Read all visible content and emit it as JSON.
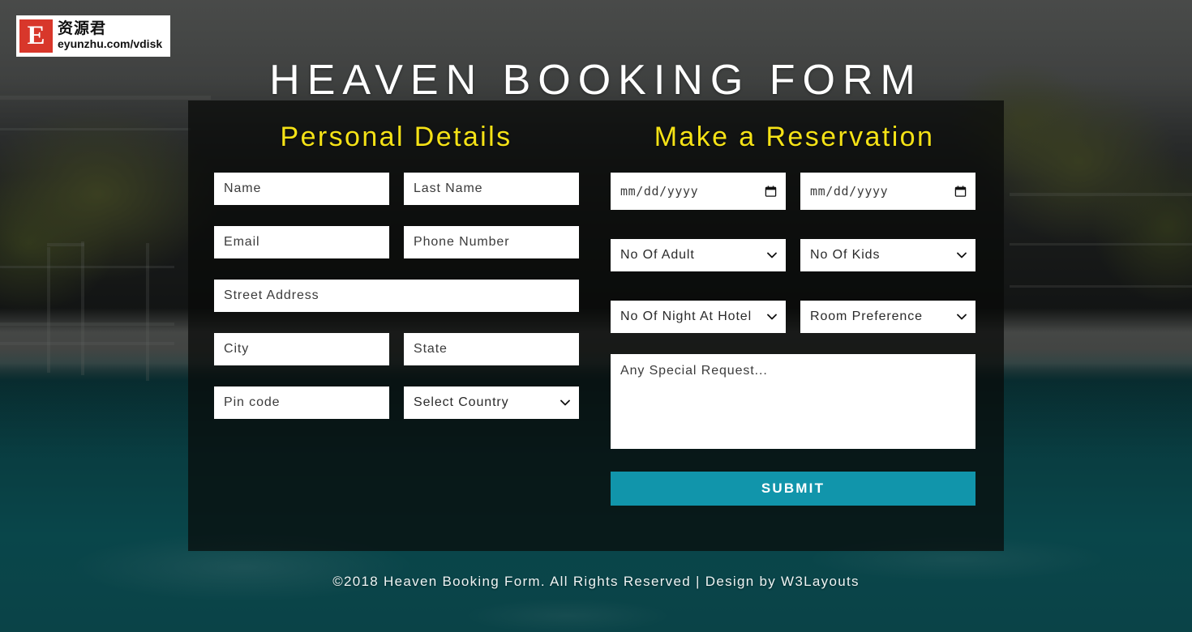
{
  "watermark": {
    "badge_letter": "E",
    "chinese": "资源君",
    "url": "eyunzhu.com/vdisk"
  },
  "header": {
    "title": "HEAVEN BOOKING FORM"
  },
  "form": {
    "personal": {
      "heading": "Personal Details",
      "fields": {
        "name": "Name",
        "last_name": "Last Name",
        "email": "Email",
        "phone": "Phone Number",
        "street": "Street Address",
        "city": "City",
        "state": "State",
        "pin": "Pin code",
        "country": "Select Country"
      }
    },
    "reservation": {
      "heading": "Make a Reservation",
      "fields": {
        "check_in": "mm/dd/yyyy",
        "check_out": "mm/dd/yyyy",
        "adults": "No Of Adult",
        "kids": "No Of Kids",
        "nights": "No Of Night At Hotel",
        "room": "Room Preference",
        "request": "Any Special Request..."
      },
      "submit": "SUBMIT"
    }
  },
  "footer": {
    "text": "©2018 Heaven Booking Form. All Rights Reserved | Design by W3Layouts"
  },
  "colors": {
    "heading_yellow": "#f5e216",
    "submit_teal": "#1195ab",
    "panel_overlay": "rgba(8,10,9,0.72)",
    "field_white": "#ffffff",
    "title_white": "#ffffff"
  }
}
